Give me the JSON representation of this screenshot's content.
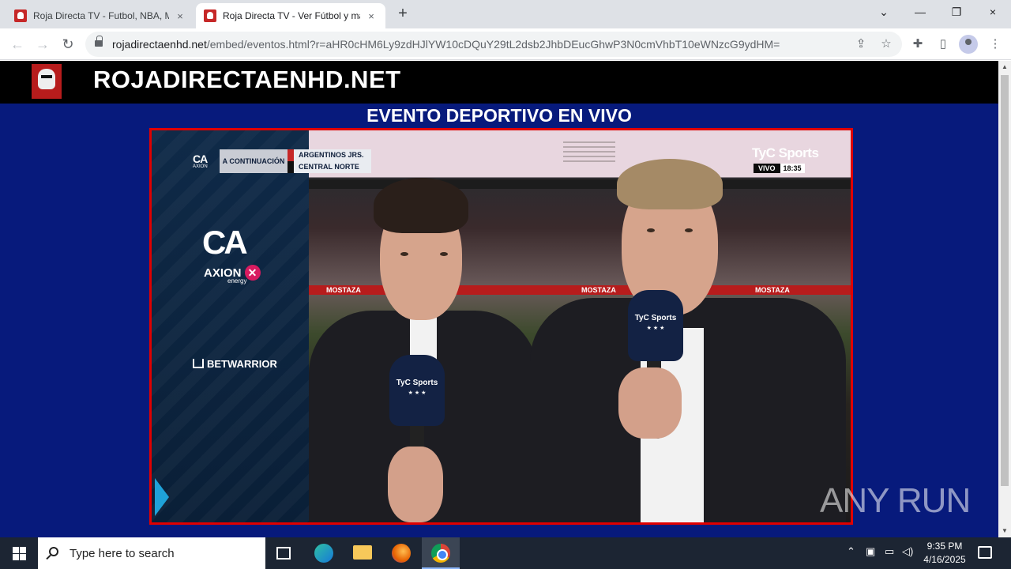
{
  "browser": {
    "tabs": [
      {
        "title": "Roja Directa TV - Futbol, NBA, M",
        "active": false
      },
      {
        "title": "Roja Directa TV - Ver Fútbol y ma",
        "active": true
      }
    ],
    "url_domain": "rojadirectaenhd.net",
    "url_path": "/embed/eventos.html?r=aHR0cHM6Ly9zdHJlYW10cDQuY29tL2dsb2JhbDEucGhwP3N0cmVhbT10eWNzcG9ydHM="
  },
  "site": {
    "title": "ROJADIRECTAENHD.NET",
    "event_heading": "EVENTO DEPORTIVO EN VIVO"
  },
  "broadcast": {
    "sponsor_logo": "CA",
    "sponsor_axion": "AXION",
    "sponsor_energy": "energy",
    "sponsor_bet": "BETWARRIOR",
    "next_label": "A CONTINUACIÓN",
    "team_1": "ARGENTINOS JRS.",
    "team_2": "CENTRAL NORTE",
    "channel": "TyC Sports",
    "live_label": "VIVO",
    "game_clock": "18:35",
    "ad_board_text": "MOSTAZA",
    "mic_brand": "TyC Sports",
    "mic_stars": "★ ★ ★"
  },
  "watermark": "ANY RUN",
  "taskbar": {
    "search_placeholder": "Type here to search",
    "time": "9:35 PM",
    "date": "4/16/2025"
  },
  "icons": {
    "close": "×",
    "new_tab": "+",
    "back": "←",
    "forward": "→",
    "reload": "↻",
    "share": "⇪",
    "star": "☆",
    "extensions": "✚",
    "sidebar": "▯",
    "menu": "⋮",
    "minimize": "—",
    "restore": "❐",
    "chevron": "⌄"
  },
  "colors": {
    "page_background": "#071a7c",
    "player_border": "#e00000",
    "header_background": "#000000"
  }
}
